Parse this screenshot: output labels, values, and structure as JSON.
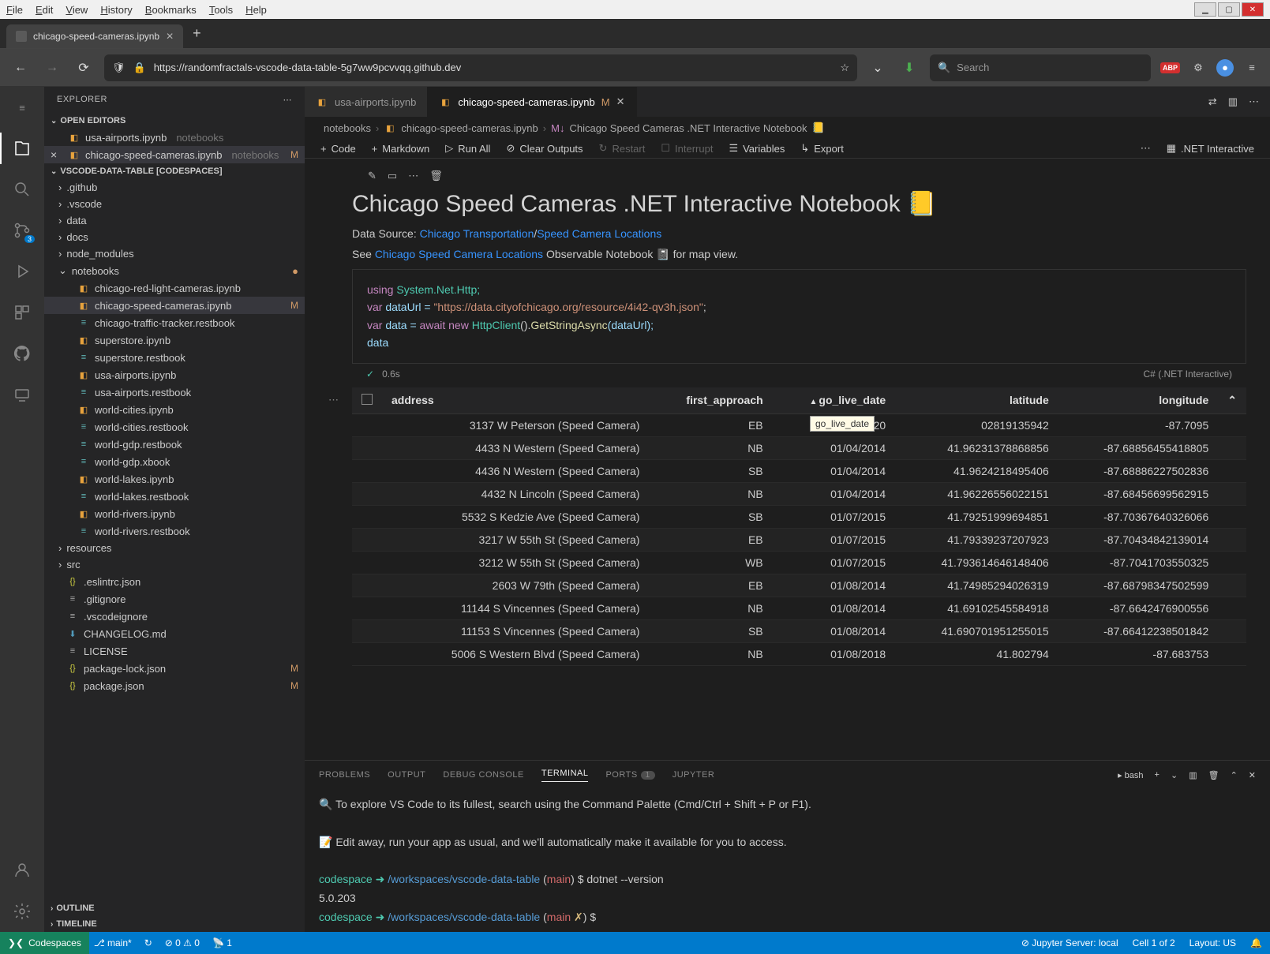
{
  "browser": {
    "menu": [
      "File",
      "Edit",
      "View",
      "History",
      "Bookmarks",
      "Tools",
      "Help"
    ],
    "tab_title": "chicago-speed-cameras.ipynb",
    "url": "https://randomfractals-vscode-data-table-5g7ww9pcvvqq.github.dev",
    "search_placeholder": "Search"
  },
  "sidebar": {
    "title": "EXPLORER",
    "open_editors": "OPEN EDITORS",
    "editors": [
      {
        "name": "usa-airports.ipynb",
        "dir": "notebooks"
      },
      {
        "name": "chicago-speed-cameras.ipynb",
        "dir": "notebooks",
        "m": "M"
      }
    ],
    "workspace": "VSCODE-DATA-TABLE [CODESPACES]",
    "folders_top": [
      ".github",
      ".vscode",
      "data",
      "docs",
      "node_modules"
    ],
    "notebooks_label": "notebooks",
    "notebook_files": [
      {
        "n": "chicago-red-light-cameras.ipynb",
        "t": "nb"
      },
      {
        "n": "chicago-speed-cameras.ipynb",
        "t": "nb",
        "m": "M",
        "active": true
      },
      {
        "n": "chicago-traffic-tracker.restbook",
        "t": "rest"
      },
      {
        "n": "superstore.ipynb",
        "t": "nb"
      },
      {
        "n": "superstore.restbook",
        "t": "rest"
      },
      {
        "n": "usa-airports.ipynb",
        "t": "nb"
      },
      {
        "n": "usa-airports.restbook",
        "t": "rest"
      },
      {
        "n": "world-cities.ipynb",
        "t": "nb"
      },
      {
        "n": "world-cities.restbook",
        "t": "rest"
      },
      {
        "n": "world-gdp.restbook",
        "t": "rest"
      },
      {
        "n": "world-gdp.xbook",
        "t": "rest"
      },
      {
        "n": "world-lakes.ipynb",
        "t": "nb"
      },
      {
        "n": "world-lakes.restbook",
        "t": "rest"
      },
      {
        "n": "world-rivers.ipynb",
        "t": "nb"
      },
      {
        "n": "world-rivers.restbook",
        "t": "rest"
      }
    ],
    "folders_after": [
      "resources",
      "src"
    ],
    "root_files": [
      {
        "n": ".eslintrc.json",
        "t": "json"
      },
      {
        "n": ".gitignore",
        "t": "txt"
      },
      {
        "n": ".vscodeignore",
        "t": "txt"
      },
      {
        "n": "CHANGELOG.md",
        "t": "md"
      },
      {
        "n": "LICENSE",
        "t": "txt"
      },
      {
        "n": "package-lock.json",
        "t": "json",
        "m": "M"
      },
      {
        "n": "package.json",
        "t": "json",
        "m": "M"
      }
    ],
    "outline": "OUTLINE",
    "timeline": "TIMELINE"
  },
  "editor": {
    "tabs": [
      {
        "label": "usa-airports.ipynb"
      },
      {
        "label": "chicago-speed-cameras.ipynb",
        "suffix": "M",
        "active": true
      }
    ],
    "breadcrumb": [
      "notebooks",
      "chicago-speed-cameras.ipynb",
      "Chicago Speed Cameras .NET Interactive Notebook"
    ],
    "nb_toolbar": {
      "code": "Code",
      "markdown": "Markdown",
      "run_all": "Run All",
      "clear": "Clear Outputs",
      "restart": "Restart",
      "interrupt": "Interrupt",
      "variables": "Variables",
      "export": "Export",
      "kernel": ".NET Interactive"
    },
    "title": "Chicago Speed Cameras .NET Interactive Notebook 📒",
    "p1_prefix": "Data Source: ",
    "p1_link1": "Chicago Transportation",
    "p1_sep": "/",
    "p1_link2": "Speed Camera Locations",
    "p2_prefix": "See ",
    "p2_link": "Chicago Speed Camera Locations",
    "p2_suffix": " Observable Notebook 📓 for map view.",
    "code": {
      "l1a": "using",
      "l1b": " System.Net.Http;",
      "l2a": "var",
      "l2b": " dataUrl = ",
      "l2c": "\"https://data.cityofchicago.org/resource/4i42-qv3h.json\"",
      "l2d": ";",
      "l3a": "var",
      "l3b": " data = ",
      "l3c": "await",
      "l3d": " new ",
      "l3e": "HttpClient",
      "l3f": "().",
      "l3g": "GetStringAsync",
      "l3h": "(dataUrl);",
      "l4": "data"
    },
    "status_time": "0.6s",
    "status_lang": "C# (.NET Interactive)",
    "columns": [
      "address",
      "first_approach",
      "go_live_date",
      "latitude",
      "longitude"
    ],
    "sort_col": "go_live_date",
    "tooltip": "go_live_date",
    "rows": [
      {
        "address": "3137 W Peterson (Speed Camera)",
        "fa": "EB",
        "date": "01/03/20",
        "lat": "02819135942",
        "lon": "-87.7095"
      },
      {
        "address": "4433 N Western (Speed Camera)",
        "fa": "NB",
        "date": "01/04/2014",
        "lat": "41.96231378868856",
        "lon": "-87.68856455418805"
      },
      {
        "address": "4436 N Western (Speed Camera)",
        "fa": "SB",
        "date": "01/04/2014",
        "lat": "41.9624218495406",
        "lon": "-87.68886227502836"
      },
      {
        "address": "4432 N Lincoln (Speed Camera)",
        "fa": "NB",
        "date": "01/04/2014",
        "lat": "41.96226556022151",
        "lon": "-87.68456699562915"
      },
      {
        "address": "5532 S Kedzie Ave (Speed Camera)",
        "fa": "SB",
        "date": "01/07/2015",
        "lat": "41.79251999694851",
        "lon": "-87.70367640326066"
      },
      {
        "address": "3217 W 55th St (Speed Camera)",
        "fa": "EB",
        "date": "01/07/2015",
        "lat": "41.79339237207923",
        "lon": "-87.70434842139014"
      },
      {
        "address": "3212 W 55th St (Speed Camera)",
        "fa": "WB",
        "date": "01/07/2015",
        "lat": "41.793614646148406",
        "lon": "-87.7041703550325"
      },
      {
        "address": "2603 W 79th (Speed Camera)",
        "fa": "EB",
        "date": "01/08/2014",
        "lat": "41.74985294026319",
        "lon": "-87.68798347502599"
      },
      {
        "address": "11144 S Vincennes (Speed Camera)",
        "fa": "NB",
        "date": "01/08/2014",
        "lat": "41.69102545584918",
        "lon": "-87.6642476900556"
      },
      {
        "address": "11153 S Vincennes (Speed Camera)",
        "fa": "SB",
        "date": "01/08/2014",
        "lat": "41.690701951255015",
        "lon": "-87.66412238501842"
      },
      {
        "address": "5006 S Western Blvd (Speed Camera)",
        "fa": "NB",
        "date": "01/08/2018",
        "lat": "41.802794",
        "lon": "-87.683753"
      }
    ]
  },
  "panel": {
    "tabs": {
      "problems": "PROBLEMS",
      "output": "OUTPUT",
      "debug": "DEBUG CONSOLE",
      "terminal": "TERMINAL",
      "ports": "PORTS",
      "ports_badge": "1",
      "jupyter": "JUPYTER"
    },
    "shell": "bash",
    "line1": "🔍  To explore VS Code to its fullest, search using the Command Palette (Cmd/Ctrl + Shift + P or F1).",
    "line2": "📝 Edit away, run your app as usual, and we'll automatically make it available for you to access.",
    "prompt_user": "codespace ➜ ",
    "prompt_path": "/workspaces/vscode-data-table",
    "prompt_branch": "main",
    "cmd1": "dotnet --version",
    "out1": "5.0.203",
    "prompt_dirty": "✗"
  },
  "status": {
    "codespaces": "Codespaces",
    "branch": "main*",
    "errors": "0",
    "warnings": "0",
    "ports": "1",
    "jupyter": "Jupyter Server: local",
    "cell": "Cell 1 of 2",
    "layout": "Layout: US"
  }
}
